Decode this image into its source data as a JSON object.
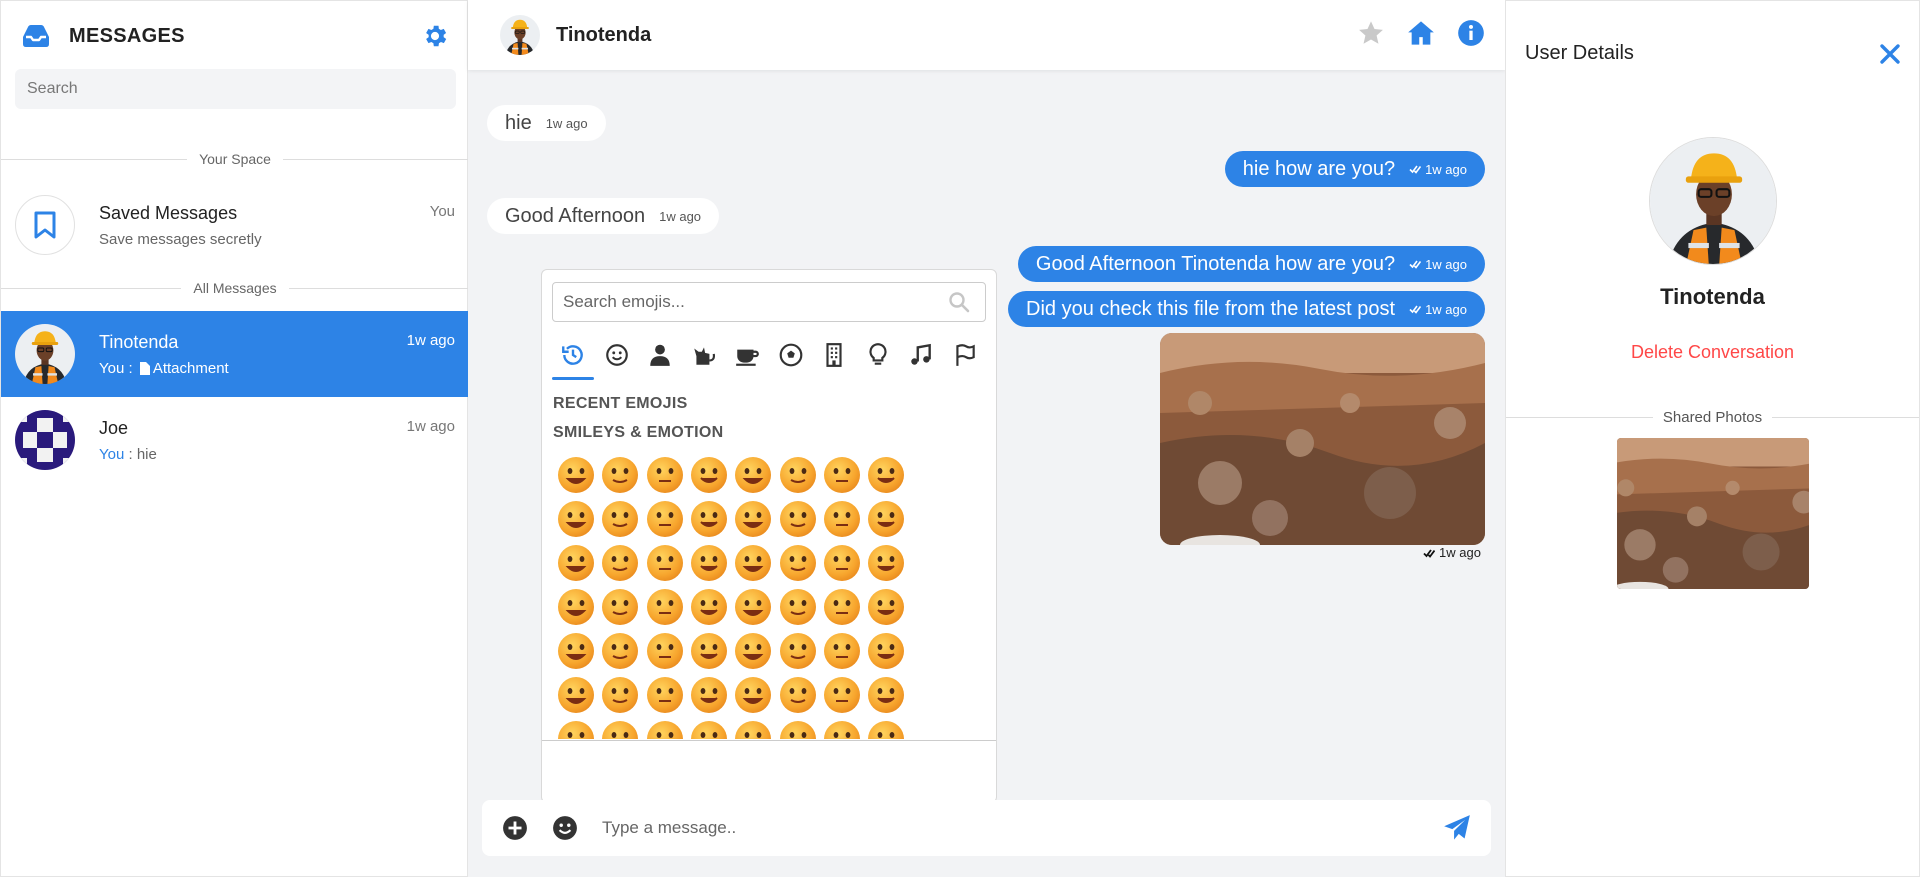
{
  "sidebar": {
    "title": "MESSAGES",
    "search_placeholder": "Search",
    "section_your_space": "Your Space",
    "section_all_messages": "All Messages",
    "saved": {
      "name": "Saved Messages",
      "sub": "Save messages secretly",
      "time": "You"
    },
    "contacts": [
      {
        "name": "Tinotenda",
        "time": "1w ago",
        "sub_prefix": "You : ",
        "sub_text": "Attachment",
        "active": true
      },
      {
        "name": "Joe",
        "time": "1w ago",
        "sub_prefix": "You",
        "sub_text": " : hie",
        "active": false
      }
    ]
  },
  "chat": {
    "contact_name": "Tinotenda",
    "messages": [
      {
        "dir": "in",
        "text": "hie",
        "time": "1w ago"
      },
      {
        "dir": "out",
        "text": "hie how are you?",
        "time": "1w ago"
      },
      {
        "dir": "in",
        "text": "Good Afternoon",
        "time": "1w ago"
      },
      {
        "dir": "out",
        "text": "Good Afternoon Tinotenda how are you?",
        "time": "1w ago"
      },
      {
        "dir": "out",
        "text": "Did you check this file from the latest post",
        "time": "1w ago"
      }
    ],
    "photo_time": "1w ago",
    "composer_placeholder": "Type a message.."
  },
  "emoji_picker": {
    "search_placeholder": "Search emojis...",
    "categories": [
      "recent-icon",
      "smileys-icon",
      "people-icon",
      "animals-icon",
      "food-icon",
      "activity-icon",
      "travel-icon",
      "objects-icon",
      "symbols-icon",
      "flags-icon"
    ],
    "section_recent": "RECENT EMOJIS",
    "section_smileys": "SMILEYS & EMOTION"
  },
  "details": {
    "title": "User Details",
    "name": "Tinotenda",
    "delete_label": "Delete Conversation",
    "shared_photos_label": "Shared Photos"
  },
  "colors": {
    "accent": "#2d83e6",
    "danger": "#ff4747",
    "chat_bg": "#f2f3f5"
  }
}
